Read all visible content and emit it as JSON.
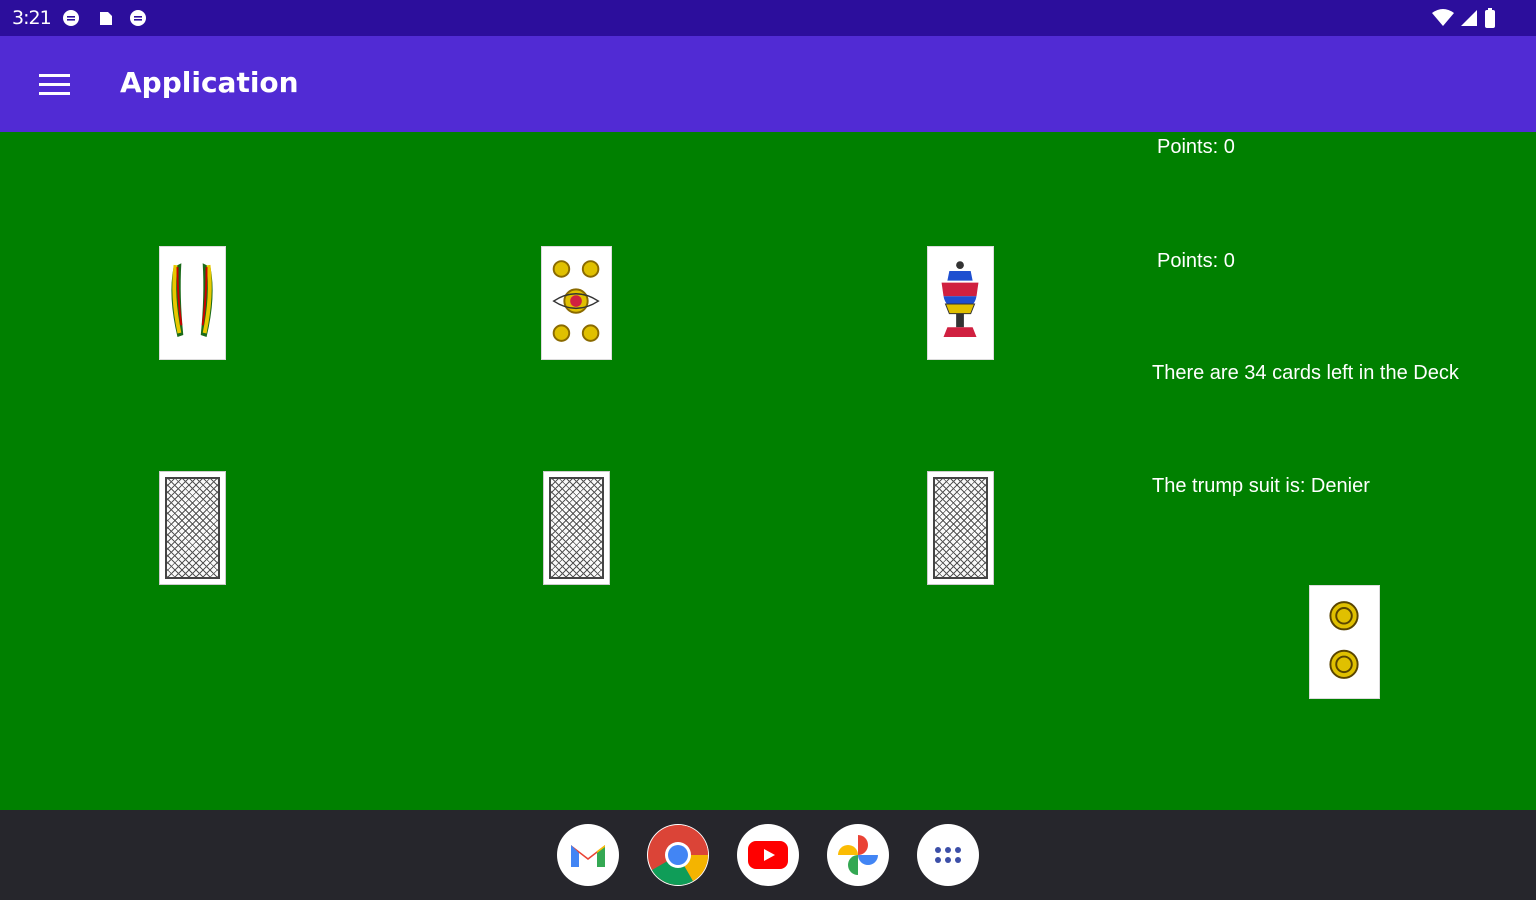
{
  "status_bar": {
    "time": "3:21",
    "left_icons": [
      "notification-circle-icon",
      "sd-card-icon",
      "notification-circle-icon"
    ],
    "right_icons": [
      "wifi-icon",
      "cell-signal-icon",
      "battery-icon"
    ]
  },
  "app_bar": {
    "title": "Application",
    "menu_icon": "hamburger-menu-icon"
  },
  "game": {
    "opponent_points": "Points: 0",
    "player_points": "Points: 0",
    "deck_status": "There are 34 cards left in the Deck",
    "trump_text": "The trump suit is: Denier",
    "player_hand": [
      {
        "suit": "Bâtons",
        "rank": "2",
        "icon": "batons-card"
      },
      {
        "suit": "Deniers",
        "rank": "5",
        "icon": "deniers-card"
      },
      {
        "suit": "Coupes",
        "rank": "1",
        "icon": "coupes-card"
      }
    ],
    "opponent_hand_count": 3,
    "trump_card": {
      "suit": "Deniers",
      "rank": "2",
      "icon": "deniers-card"
    }
  },
  "colors": {
    "status_bar": "#2c0e9c",
    "app_bar": "#512bd4",
    "table": "#008000",
    "dock": "#26262c"
  },
  "dock": {
    "apps": [
      "Gmail",
      "Chrome",
      "YouTube",
      "Photos",
      "App drawer"
    ]
  }
}
